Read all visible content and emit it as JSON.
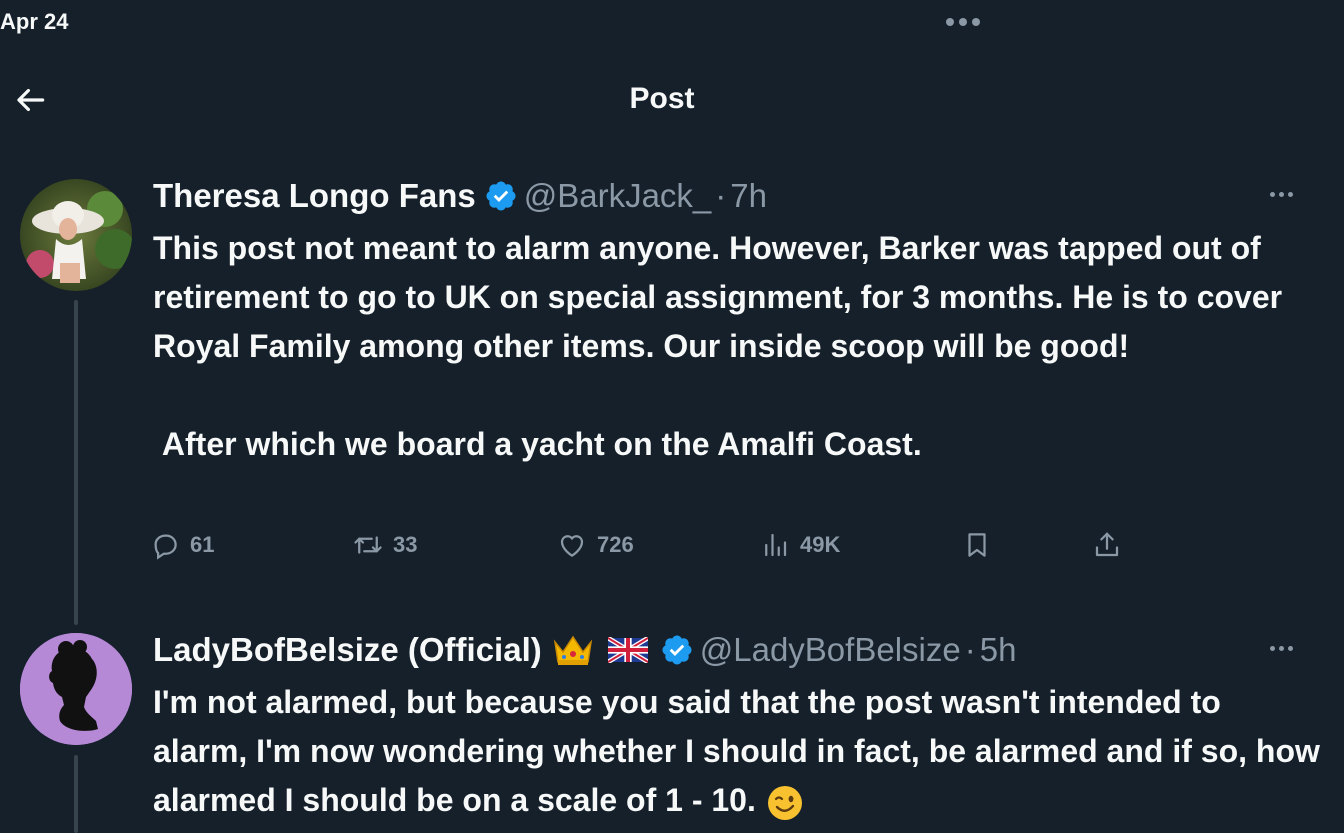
{
  "status_bar": {
    "date": "Apr 24"
  },
  "header": {
    "title": "Post"
  },
  "posts": [
    {
      "display_name": "Theresa Longo Fans",
      "handle": "@BarkJack_",
      "time": "7h",
      "text": "This post not meant to alarm anyone. However, Barker was tapped out of retirement to go to UK on special assignment, for 3 months. He is to cover Royal Family among other items. Our inside scoop will be good!\n\n After which we board a yacht on the Amalfi Coast.",
      "stats": {
        "replies": "61",
        "reposts": "33",
        "likes": "726",
        "views": "49K"
      }
    },
    {
      "display_name": "LadyBofBelsize (Official)",
      "handle": "@LadyBofBelsize",
      "time": "5h",
      "text": "I'm not alarmed, but because you said that the post wasn't intended to alarm, I'm now wondering whether I should in fact, be alarmed and if so, how alarmed I should be on a scale of 1 - 10.",
      "emojis": [
        "crown",
        "uk-flag",
        "wink"
      ]
    }
  ],
  "colors": {
    "background": "#15202b",
    "text": "#f7f9f9",
    "secondary": "#8b98a5",
    "verified": "#1d9bf0",
    "thread_line": "#38444d"
  }
}
